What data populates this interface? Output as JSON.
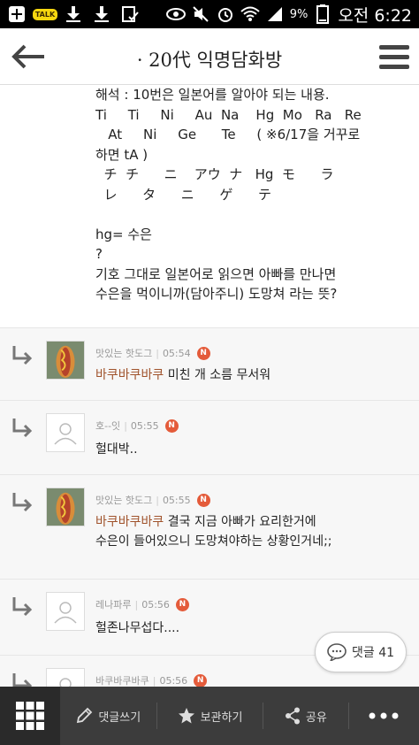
{
  "status_bar": {
    "kakaotalk_badge": "TALK",
    "battery_percent": "9%",
    "time": "오전 6:22"
  },
  "header": {
    "title": "· 20代 익명담화방"
  },
  "post": {
    "lines": [
      "해석 : 10번은 일본어를 알아야 되는 내용.",
      "Ti     Ti     Ni     Au  Na    Hg  Mo   Ra   Re",
      "   At     Ni     Ge      Te     ( ※6/17을 거꾸로",
      "하면 tA )",
      "  チ  チ      ニ    アウ  ナ   Hg  モ      ラ",
      "  レ      タ      ニ      ゲ      テ",
      "",
      "hg= 수은",
      "?",
      "기호 그대로 일본어로 읽으면 아빠를 만나면",
      "수은을 먹이니까(담아주니) 도망쳐 라는 뜻?"
    ]
  },
  "comments": [
    {
      "author": "맛있는 핫도그",
      "time": "05:54",
      "badge": "N",
      "mention": "바쿠바쿠바쿠",
      "lines": [
        " 미친 개 소름 무서워"
      ],
      "avatar": "hotdog"
    },
    {
      "author": "호--잇",
      "time": "05:55",
      "badge": "N",
      "mention": "",
      "lines": [
        "헐대박.."
      ],
      "avatar": "default"
    },
    {
      "author": "맛있는 핫도그",
      "time": "05:55",
      "badge": "N",
      "mention": "바쿠바쿠바쿠",
      "lines": [
        " 결국 지금 아빠가 요리한거에",
        "수은이 들어있으니 도망쳐야하는 상황인거네;;"
      ],
      "avatar": "hotdog"
    },
    {
      "author": "레나파루",
      "time": "05:56",
      "badge": "N",
      "mention": "",
      "lines": [
        "헐존나무섭다...."
      ],
      "avatar": "default"
    },
    {
      "author": "바쿠바쿠바쿠",
      "time": "05:56",
      "badge": "N",
      "mention": "",
      "lines": [
        ""
      ],
      "avatar": "default"
    }
  ],
  "comment_float": {
    "label": "댓글 41"
  },
  "bottom_bar": {
    "write": "댓글쓰기",
    "save": "보관하기",
    "share": "공유"
  }
}
